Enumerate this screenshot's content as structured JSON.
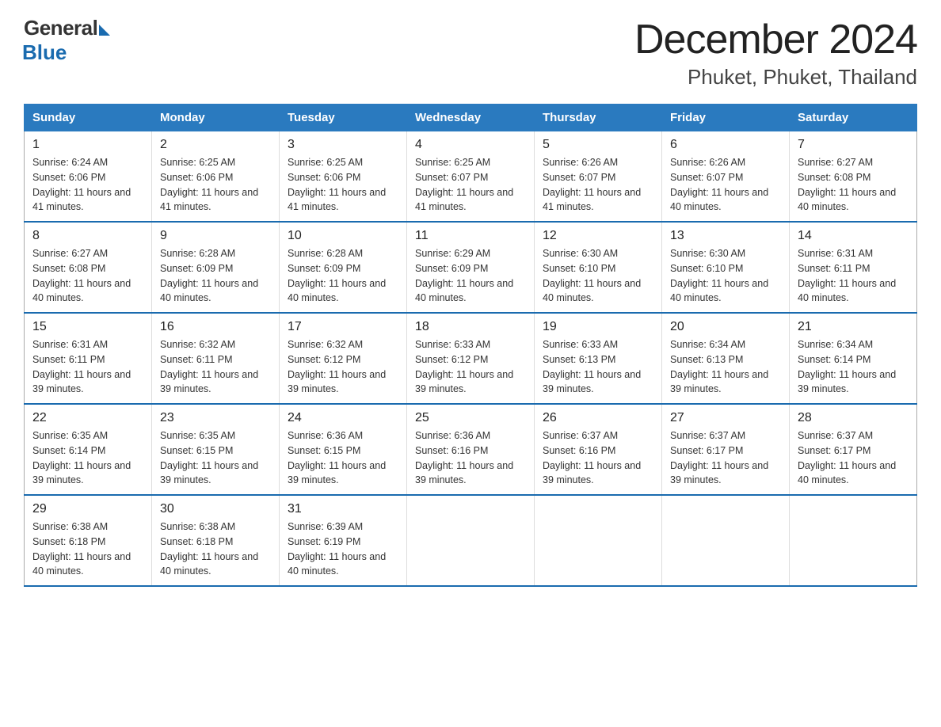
{
  "logo": {
    "general": "General",
    "blue": "Blue"
  },
  "title": {
    "month": "December 2024",
    "location": "Phuket, Phuket, Thailand"
  },
  "headers": [
    "Sunday",
    "Monday",
    "Tuesday",
    "Wednesday",
    "Thursday",
    "Friday",
    "Saturday"
  ],
  "weeks": [
    [
      {
        "day": "1",
        "sunrise": "6:24 AM",
        "sunset": "6:06 PM",
        "daylight": "11 hours and 41 minutes."
      },
      {
        "day": "2",
        "sunrise": "6:25 AM",
        "sunset": "6:06 PM",
        "daylight": "11 hours and 41 minutes."
      },
      {
        "day": "3",
        "sunrise": "6:25 AM",
        "sunset": "6:06 PM",
        "daylight": "11 hours and 41 minutes."
      },
      {
        "day": "4",
        "sunrise": "6:25 AM",
        "sunset": "6:07 PM",
        "daylight": "11 hours and 41 minutes."
      },
      {
        "day": "5",
        "sunrise": "6:26 AM",
        "sunset": "6:07 PM",
        "daylight": "11 hours and 41 minutes."
      },
      {
        "day": "6",
        "sunrise": "6:26 AM",
        "sunset": "6:07 PM",
        "daylight": "11 hours and 40 minutes."
      },
      {
        "day": "7",
        "sunrise": "6:27 AM",
        "sunset": "6:08 PM",
        "daylight": "11 hours and 40 minutes."
      }
    ],
    [
      {
        "day": "8",
        "sunrise": "6:27 AM",
        "sunset": "6:08 PM",
        "daylight": "11 hours and 40 minutes."
      },
      {
        "day": "9",
        "sunrise": "6:28 AM",
        "sunset": "6:09 PM",
        "daylight": "11 hours and 40 minutes."
      },
      {
        "day": "10",
        "sunrise": "6:28 AM",
        "sunset": "6:09 PM",
        "daylight": "11 hours and 40 minutes."
      },
      {
        "day": "11",
        "sunrise": "6:29 AM",
        "sunset": "6:09 PM",
        "daylight": "11 hours and 40 minutes."
      },
      {
        "day": "12",
        "sunrise": "6:30 AM",
        "sunset": "6:10 PM",
        "daylight": "11 hours and 40 minutes."
      },
      {
        "day": "13",
        "sunrise": "6:30 AM",
        "sunset": "6:10 PM",
        "daylight": "11 hours and 40 minutes."
      },
      {
        "day": "14",
        "sunrise": "6:31 AM",
        "sunset": "6:11 PM",
        "daylight": "11 hours and 40 minutes."
      }
    ],
    [
      {
        "day": "15",
        "sunrise": "6:31 AM",
        "sunset": "6:11 PM",
        "daylight": "11 hours and 39 minutes."
      },
      {
        "day": "16",
        "sunrise": "6:32 AM",
        "sunset": "6:11 PM",
        "daylight": "11 hours and 39 minutes."
      },
      {
        "day": "17",
        "sunrise": "6:32 AM",
        "sunset": "6:12 PM",
        "daylight": "11 hours and 39 minutes."
      },
      {
        "day": "18",
        "sunrise": "6:33 AM",
        "sunset": "6:12 PM",
        "daylight": "11 hours and 39 minutes."
      },
      {
        "day": "19",
        "sunrise": "6:33 AM",
        "sunset": "6:13 PM",
        "daylight": "11 hours and 39 minutes."
      },
      {
        "day": "20",
        "sunrise": "6:34 AM",
        "sunset": "6:13 PM",
        "daylight": "11 hours and 39 minutes."
      },
      {
        "day": "21",
        "sunrise": "6:34 AM",
        "sunset": "6:14 PM",
        "daylight": "11 hours and 39 minutes."
      }
    ],
    [
      {
        "day": "22",
        "sunrise": "6:35 AM",
        "sunset": "6:14 PM",
        "daylight": "11 hours and 39 minutes."
      },
      {
        "day": "23",
        "sunrise": "6:35 AM",
        "sunset": "6:15 PM",
        "daylight": "11 hours and 39 minutes."
      },
      {
        "day": "24",
        "sunrise": "6:36 AM",
        "sunset": "6:15 PM",
        "daylight": "11 hours and 39 minutes."
      },
      {
        "day": "25",
        "sunrise": "6:36 AM",
        "sunset": "6:16 PM",
        "daylight": "11 hours and 39 minutes."
      },
      {
        "day": "26",
        "sunrise": "6:37 AM",
        "sunset": "6:16 PM",
        "daylight": "11 hours and 39 minutes."
      },
      {
        "day": "27",
        "sunrise": "6:37 AM",
        "sunset": "6:17 PM",
        "daylight": "11 hours and 39 minutes."
      },
      {
        "day": "28",
        "sunrise": "6:37 AM",
        "sunset": "6:17 PM",
        "daylight": "11 hours and 40 minutes."
      }
    ],
    [
      {
        "day": "29",
        "sunrise": "6:38 AM",
        "sunset": "6:18 PM",
        "daylight": "11 hours and 40 minutes."
      },
      {
        "day": "30",
        "sunrise": "6:38 AM",
        "sunset": "6:18 PM",
        "daylight": "11 hours and 40 minutes."
      },
      {
        "day": "31",
        "sunrise": "6:39 AM",
        "sunset": "6:19 PM",
        "daylight": "11 hours and 40 minutes."
      },
      null,
      null,
      null,
      null
    ]
  ],
  "sunrise_label": "Sunrise:",
  "sunset_label": "Sunset:",
  "daylight_label": "Daylight:"
}
